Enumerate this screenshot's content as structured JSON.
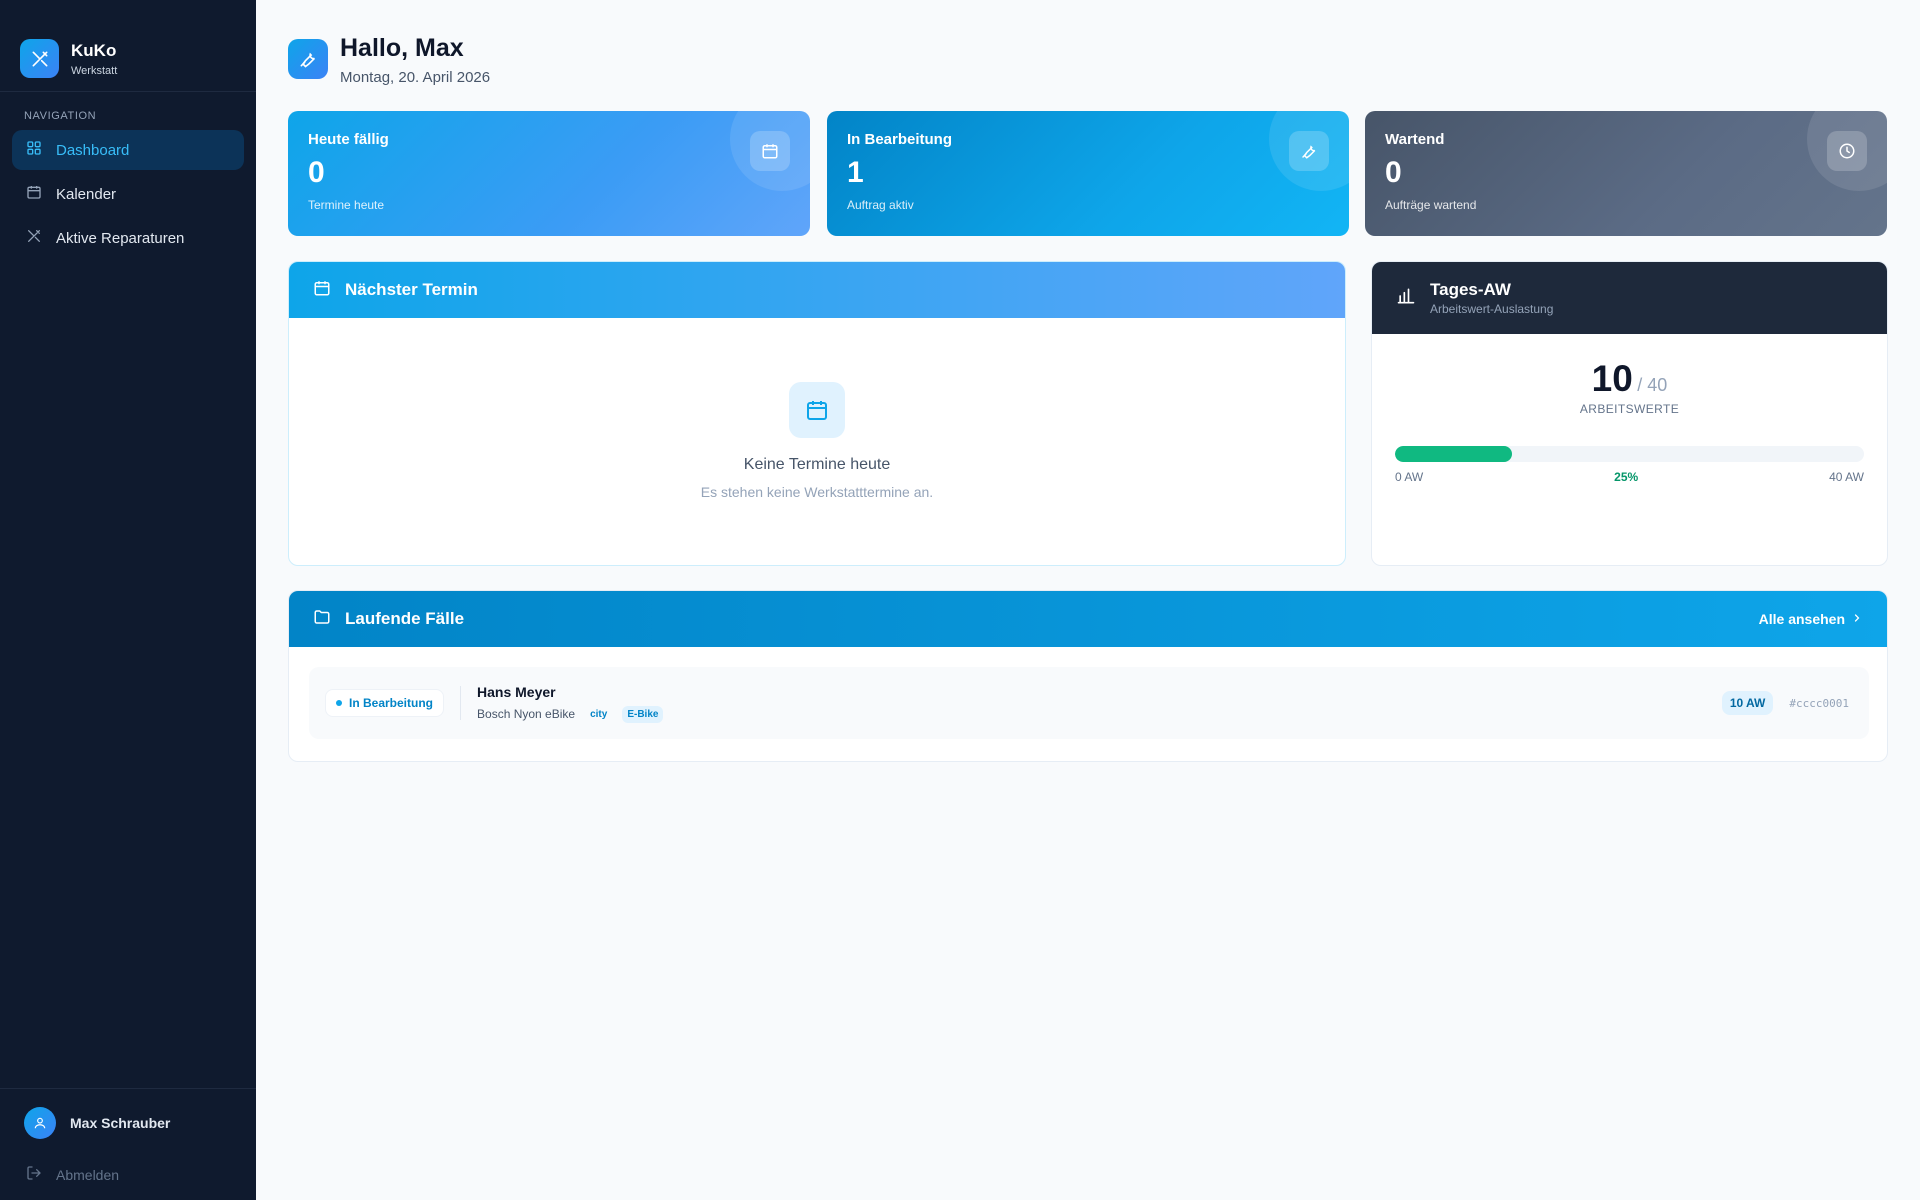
{
  "app": {
    "name": "KuKo",
    "subtitle": "Werkstatt",
    "accent": "#0ea5e9"
  },
  "nav": {
    "heading": "NAVIGATION",
    "items": [
      {
        "label": "Dashboard",
        "icon": "grid-icon",
        "active": true
      },
      {
        "label": "Kalender",
        "icon": "calendar-icon",
        "active": false
      },
      {
        "label": "Aktive Reparaturen",
        "icon": "tools-icon",
        "active": false
      }
    ]
  },
  "user": {
    "name": "Max Schrauber",
    "logout_label": "Abmelden"
  },
  "header": {
    "greeting": "Hallo, Max",
    "date": "Montag, 20. April 2026"
  },
  "stats": [
    {
      "label": "Heute fällig",
      "value": "0",
      "caption": "Termine heute",
      "icon": "calendar-icon"
    },
    {
      "label": "In Bearbeitung",
      "value": "1",
      "caption": "Auftrag aktiv",
      "icon": "wrench-icon"
    },
    {
      "label": "Wartend",
      "value": "0",
      "caption": "Aufträge wartend",
      "icon": "clock-icon"
    }
  ],
  "next_appointment": {
    "title": "Nächster Termin",
    "empty_title": "Keine Termine heute",
    "empty_sub": "Es stehen keine Werkstatttermine an."
  },
  "daily_aw": {
    "title": "Tages-AW",
    "subtitle": "Arbeitswert-Auslastung",
    "value": "10",
    "total": "/ 40",
    "unit": "ARBEITSWERTE",
    "progress": 0.25,
    "min_label": "0 AW",
    "pct_label": "25%",
    "max_label": "40 AW",
    "bar_color": "#10b981"
  },
  "cases": {
    "title": "Laufende Fälle",
    "see_all": "Alle ansehen",
    "rows": [
      {
        "status": "In Bearbeitung",
        "customer": "Hans Meyer",
        "bike": "Bosch Nyon eBike",
        "tags": [
          "city",
          "E-Bike"
        ],
        "aw": "10 AW",
        "id": "#cccc0001"
      }
    ]
  }
}
